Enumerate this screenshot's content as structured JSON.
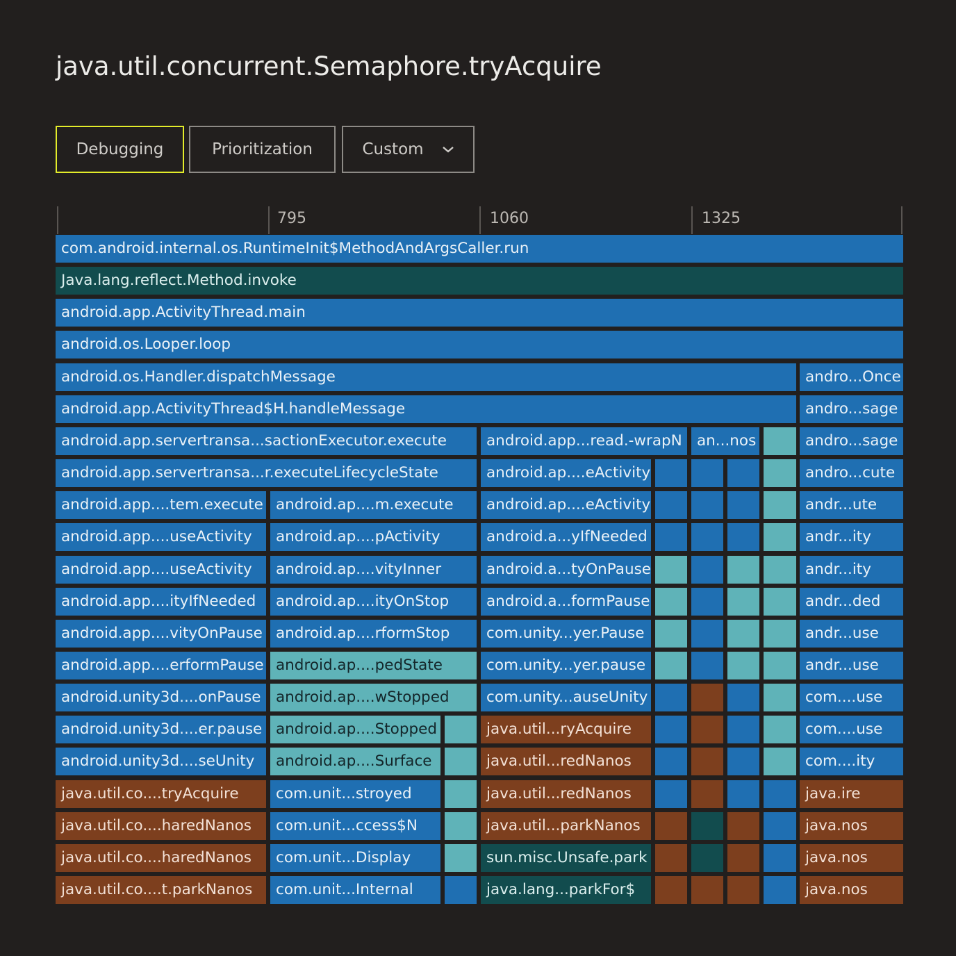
{
  "title": "java.util.concurrent.Semaphore.tryAcquire",
  "tabs": {
    "debugging": "Debugging",
    "prioritization": "Prioritization",
    "custom": "Custom",
    "custom_icon": "chevron-down-icon"
  },
  "axis": {
    "ticks": [
      "795",
      "1060",
      "1325"
    ]
  },
  "colors": {
    "background": "#221f1e",
    "active_tab": "#e3ec2a",
    "blue": "#1f6fb2",
    "teal": "#5fb3b8",
    "dark_teal": "#124c4e",
    "rust": "#7d3f1e"
  },
  "rows": [
    [
      [
        "com.android.internal.os.RuntimeInit$MethodAndArgsCaller.run",
        "blue"
      ]
    ],
    [
      [
        "Java.lang.reflect.Method.invoke",
        "dteal"
      ]
    ],
    [
      [
        "android.app.ActivityThread.main",
        "blue"
      ]
    ],
    [
      [
        "android.os.Looper.loop",
        "blue"
      ]
    ],
    [
      [
        "android.os.Handler.dispatchMessage",
        "blue"
      ],
      [
        "andro...Once",
        "blue"
      ]
    ],
    [
      [
        "android.app.ActivityThread$H.handleMessage",
        "blue"
      ],
      [
        "andro...sage",
        "blue"
      ]
    ],
    [
      [
        "android.app.servertransa...sactionExecutor.execute",
        "blue"
      ],
      [
        "android.app...read.-wrapN",
        "blue"
      ],
      [
        "an...nos",
        "blue"
      ],
      [
        "",
        "teal"
      ],
      [
        "andro...sage",
        "blue"
      ]
    ],
    [
      [
        "android.app.servertransa...r.executeLifecycleState",
        "blue"
      ],
      [
        "android.ap....eActivity",
        "blue"
      ],
      [
        "",
        "blue"
      ],
      [
        "",
        "blue"
      ],
      [
        "",
        "blue"
      ],
      [
        "",
        "teal"
      ],
      [
        "andro...cute",
        "blue"
      ]
    ],
    [
      [
        "android.app....tem.execute",
        "blue"
      ],
      [
        "android.ap....m.execute",
        "blue"
      ],
      [
        "android.ap....eActivity",
        "blue"
      ],
      [
        "",
        "blue"
      ],
      [
        "",
        "blue"
      ],
      [
        "",
        "blue"
      ],
      [
        "",
        "teal"
      ],
      [
        "andr...ute",
        "blue"
      ]
    ],
    [
      [
        "android.app....useActivity",
        "blue"
      ],
      [
        "android.ap....pActivity",
        "blue"
      ],
      [
        "android.a...yIfNeeded",
        "blue"
      ],
      [
        "",
        "blue"
      ],
      [
        "",
        "blue"
      ],
      [
        "",
        "blue"
      ],
      [
        "",
        "teal"
      ],
      [
        "andr...ity",
        "blue"
      ]
    ],
    [
      [
        "android.app....useActivity",
        "blue"
      ],
      [
        "android.ap....vityInner",
        "blue"
      ],
      [
        "android.a...tyOnPause",
        "blue"
      ],
      [
        "",
        "teal"
      ],
      [
        "",
        "blue"
      ],
      [
        "",
        "teal"
      ],
      [
        "",
        "teal"
      ],
      [
        "andr...ity",
        "blue"
      ]
    ],
    [
      [
        "android.app....ityIfNeeded",
        "blue"
      ],
      [
        "android.ap....ityOnStop",
        "blue"
      ],
      [
        "android.a...formPause",
        "blue"
      ],
      [
        "",
        "teal"
      ],
      [
        "",
        "blue"
      ],
      [
        "",
        "teal"
      ],
      [
        "",
        "teal"
      ],
      [
        "andr...ded",
        "blue"
      ]
    ],
    [
      [
        "android.app....vityOnPause",
        "blue"
      ],
      [
        "android.ap....rformStop",
        "blue"
      ],
      [
        "com.unity...yer.Pause",
        "blue"
      ],
      [
        "",
        "teal"
      ],
      [
        "",
        "blue"
      ],
      [
        "",
        "teal"
      ],
      [
        "",
        "teal"
      ],
      [
        "andr...use",
        "blue"
      ]
    ],
    [
      [
        "android.app....erformPause",
        "blue"
      ],
      [
        "android.ap....pedState",
        "teal"
      ],
      [
        "com.unity...yer.pause",
        "blue"
      ],
      [
        "",
        "teal"
      ],
      [
        "",
        "blue"
      ],
      [
        "",
        "teal"
      ],
      [
        "",
        "teal"
      ],
      [
        "andr...use",
        "blue"
      ]
    ],
    [
      [
        "android.unity3d....onPause",
        "blue"
      ],
      [
        "android.ap....wStopped",
        "teal"
      ],
      [
        "com.unity...auseUnity",
        "blue"
      ],
      [
        "",
        "blue"
      ],
      [
        "",
        "rust"
      ],
      [
        "",
        "blue"
      ],
      [
        "",
        "teal"
      ],
      [
        "com....use",
        "blue"
      ]
    ],
    [
      [
        "android.unity3d....er.pause",
        "blue"
      ],
      [
        "android.ap....Stopped",
        "teal"
      ],
      [
        "",
        "teal"
      ],
      [
        "java.util...ryAcquire",
        "rust"
      ],
      [
        "",
        "blue"
      ],
      [
        "",
        "rust"
      ],
      [
        "",
        "blue"
      ],
      [
        "",
        "teal"
      ],
      [
        "com....use",
        "blue"
      ]
    ],
    [
      [
        "android.unity3d....seUnity",
        "blue"
      ],
      [
        "android.ap....Surface",
        "teal"
      ],
      [
        "",
        "teal"
      ],
      [
        "java.util...redNanos",
        "rust"
      ],
      [
        "",
        "blue"
      ],
      [
        "",
        "rust"
      ],
      [
        "",
        "blue"
      ],
      [
        "",
        "teal"
      ],
      [
        "com....ity",
        "blue"
      ]
    ],
    [
      [
        "java.util.co....tryAcquire",
        "rust"
      ],
      [
        "com.unit...stroyed",
        "blue"
      ],
      [
        "",
        "teal"
      ],
      [
        "java.util...redNanos",
        "rust"
      ],
      [
        "",
        "blue"
      ],
      [
        "",
        "rust"
      ],
      [
        "",
        "blue"
      ],
      [
        "",
        "blue"
      ],
      [
        "java.ire",
        "rust"
      ]
    ],
    [
      [
        "java.util.co....haredNanos",
        "rust"
      ],
      [
        "com.unit...ccess$N",
        "blue"
      ],
      [
        "",
        "teal"
      ],
      [
        "java.util...parkNanos",
        "rust"
      ],
      [
        "",
        "rust"
      ],
      [
        "",
        "dteal"
      ],
      [
        "",
        "rust"
      ],
      [
        "",
        "blue"
      ],
      [
        "java.nos",
        "rust"
      ]
    ],
    [
      [
        "java.util.co....haredNanos",
        "rust"
      ],
      [
        "com.unit...Display",
        "blue"
      ],
      [
        "",
        "teal"
      ],
      [
        "sun.misc.Unsafe.park",
        "dteal"
      ],
      [
        "",
        "rust"
      ],
      [
        "",
        "dteal"
      ],
      [
        "",
        "rust"
      ],
      [
        "",
        "blue"
      ],
      [
        "java.nos",
        "rust"
      ]
    ],
    [
      [
        "java.util.co....t.parkNanos",
        "rust"
      ],
      [
        "com.unit...Internal",
        "blue"
      ],
      [
        "",
        "blue"
      ],
      [
        "java.lang...parkFor$",
        "dteal"
      ],
      [
        "",
        "rust"
      ],
      [
        "",
        "rust"
      ],
      [
        "",
        "rust"
      ],
      [
        "",
        "blue"
      ],
      [
        "java.nos",
        "rust"
      ]
    ]
  ]
}
